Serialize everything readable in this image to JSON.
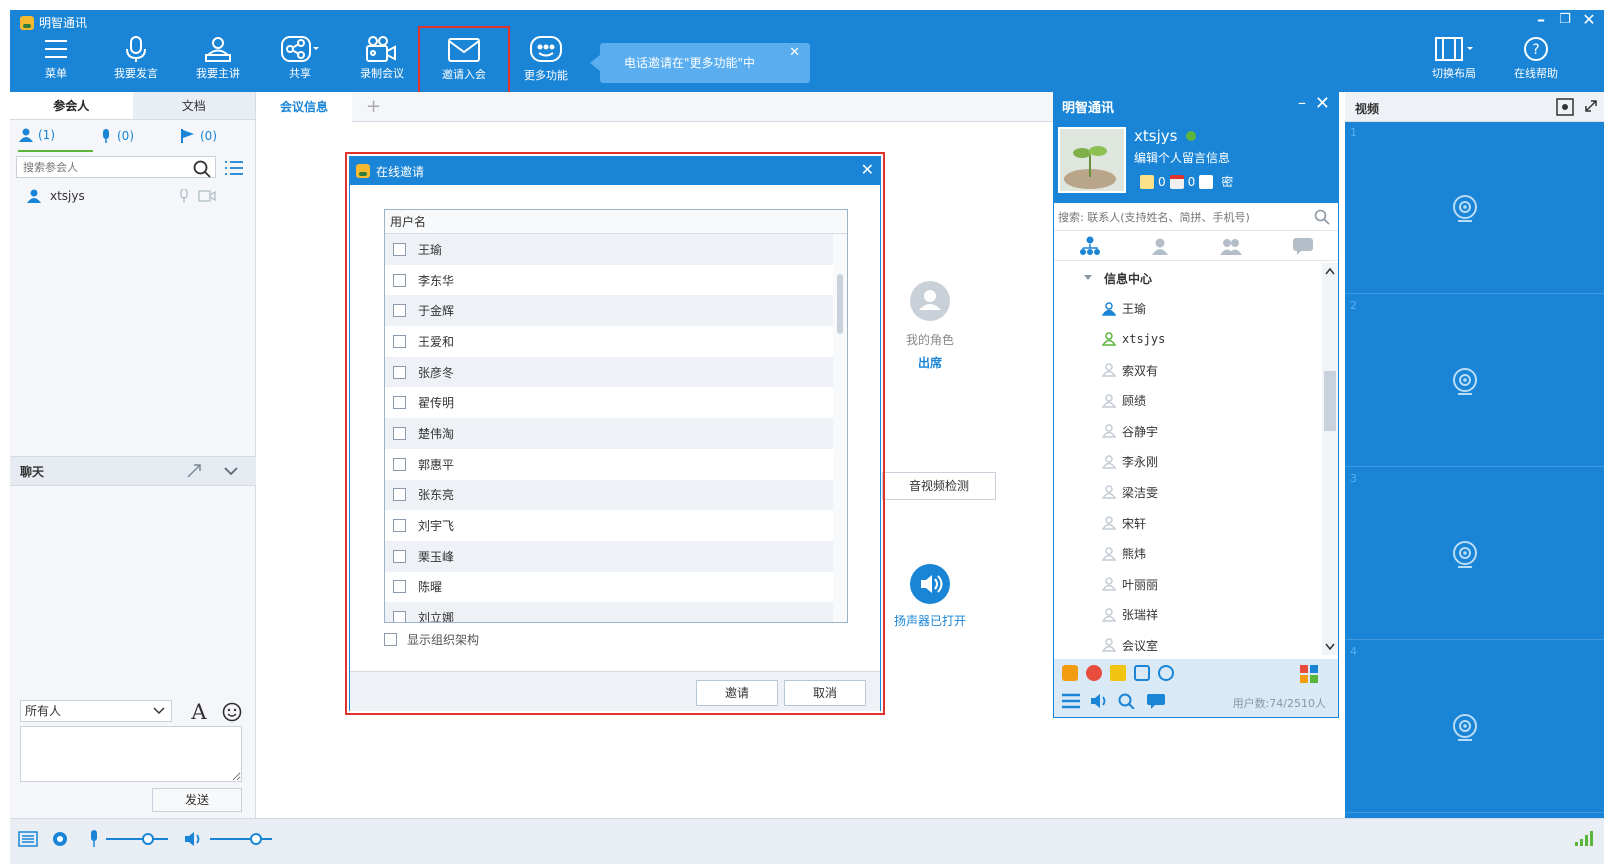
{
  "app": {
    "title": "明智通讯"
  },
  "toolbar": {
    "menu": "菜单",
    "speak": "我要发言",
    "present": "我要主讲",
    "share": "共享",
    "record": "录制会议",
    "invite": "邀请入会",
    "more": "更多功能",
    "layout": "切换布局",
    "help": "在线帮助",
    "tip": "电话邀请在\"更多功能\"中"
  },
  "left": {
    "tab_participants": "参会人",
    "tab_docs": "文档",
    "count_users": "(1)",
    "count_mic": "(0)",
    "count_flag": "(0)",
    "search_placeholder": "搜索参会人",
    "participants": [
      "xtsjys"
    ],
    "chat_title": "聊天",
    "recipient": "所有人",
    "send": "发送"
  },
  "meeting": {
    "tab": "会议信息",
    "role_label": "我的角色",
    "role_value": "出席",
    "av_check": "音视频检测",
    "speaker_status": "扬声器已打开"
  },
  "dialog": {
    "title": "在线邀请",
    "header": "用户名",
    "users": [
      "王瑜",
      "李东华",
      "于金辉",
      "王爱和",
      "张彦冬",
      "翟传明",
      "楚伟淘",
      "郭惠平",
      "张东亮",
      "刘宇飞",
      "栗玉峰",
      "陈曜",
      "刘立娜"
    ],
    "show_org": "显示组织架构",
    "invite": "邀请",
    "cancel": "取消"
  },
  "contacts": {
    "title": "明智通讯",
    "username": "xtsjys",
    "signature": "编辑个人留言信息",
    "stat1": "0",
    "stat2": "0",
    "stat3": "密",
    "search_placeholder": "搜索: 联系人(支持姓名、简拼、手机号)",
    "group": "信息中心",
    "members": [
      "王瑜",
      "xtsjys",
      "索双有",
      "顾绩",
      "谷静宇",
      "李永刚",
      "梁洁雯",
      "宋轩",
      "熊炜",
      "叶丽丽",
      "张瑞祥",
      "会议室"
    ],
    "user_count": "用户数:74/2510人"
  },
  "video": {
    "title": "视频",
    "cells": [
      "1",
      "2",
      "3",
      "4"
    ]
  },
  "colors": {
    "brand": "#1a85d6",
    "highlight": "#e0332b",
    "accent": "#5cb53b"
  }
}
